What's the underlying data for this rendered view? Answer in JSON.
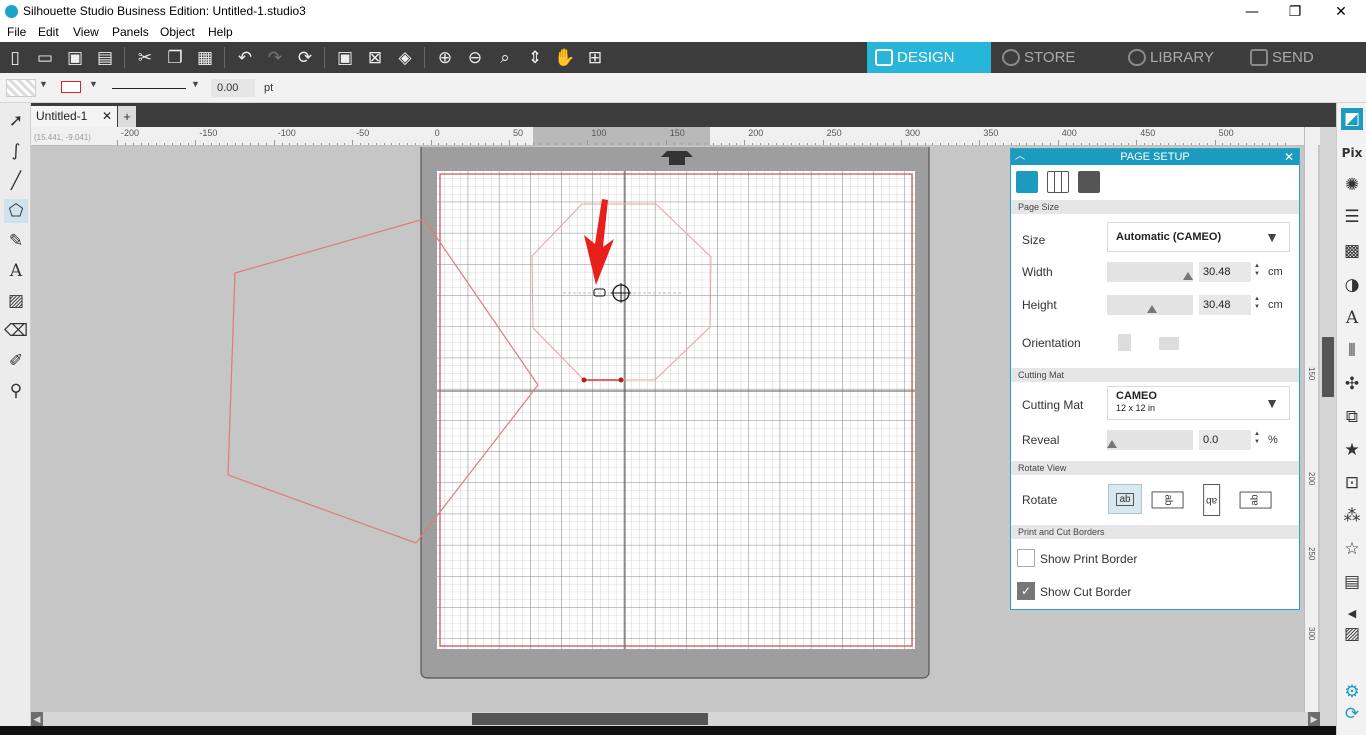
{
  "window": {
    "title": "Silhouette Studio Business Edition: Untitled-1.studio3",
    "minimize": "—",
    "maximize": "❐",
    "close": "✕"
  },
  "menu": [
    "File",
    "Edit",
    "View",
    "Panels",
    "Object",
    "Help"
  ],
  "nav_tabs": [
    {
      "label": "DESIGN",
      "active": true
    },
    {
      "label": "STORE",
      "active": false
    },
    {
      "label": "LIBRARY",
      "active": false
    },
    {
      "label": "SEND",
      "active": false
    }
  ],
  "propbar": {
    "line_width_value": "0.00",
    "line_width_unit": "pt"
  },
  "document": {
    "tab_label": "Untitled-1",
    "tab_close": "✕",
    "add_tab": "+",
    "coords": "(15.441, -9.041)"
  },
  "ruler": {
    "top_labels": [
      "-200",
      "-150",
      "-100",
      "-50",
      "0",
      "50",
      "100",
      "150",
      "200",
      "250",
      "300",
      "350",
      "400",
      "450",
      "500"
    ],
    "right_labels": [
      "150",
      "200",
      "250",
      "300"
    ]
  },
  "page_setup": {
    "title": "PAGE SETUP",
    "sections": {
      "page_size": "Page Size",
      "cutting_mat": "Cutting Mat",
      "rotate_view": "Rotate View",
      "borders": "Print and Cut Borders"
    },
    "size_label": "Size",
    "size_value": "Automatic (CAMEO)",
    "width_label": "Width",
    "width_value": "30.48",
    "height_label": "Height",
    "height_value": "30.48",
    "unit_cm": "cm",
    "orientation_label": "Orientation",
    "cutting_mat_label": "Cutting Mat",
    "cutting_mat_value": "CAMEO",
    "cutting_mat_sub": "12 x 12 in",
    "reveal_label": "Reveal",
    "reveal_value": "0.0",
    "unit_percent": "%",
    "rotate_label": "Rotate",
    "rotate_options": [
      "ab",
      "ab",
      "ab",
      "ab"
    ],
    "show_print_border": {
      "label": "Show Print Border",
      "checked": false
    },
    "show_cut_border": {
      "label": "Show Cut Border",
      "checked": true
    }
  },
  "colors": {
    "accent": "#27b5d9",
    "toolbar_bg": "#3c3c3c",
    "cut_line": "#e06b6b",
    "annotation_arrow": "#e8201c"
  }
}
